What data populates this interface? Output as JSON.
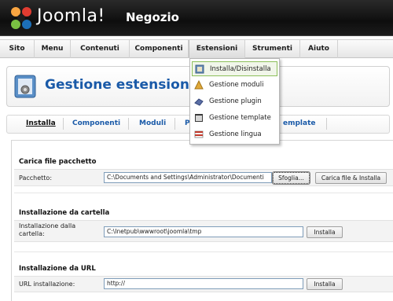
{
  "header": {
    "brand": "Joomla!",
    "site_name": "Negozio"
  },
  "menu": {
    "items": [
      "Sito",
      "Menu",
      "Contenuti",
      "Componenti",
      "Estensioni",
      "Strumenti",
      "Aiuto"
    ]
  },
  "dropdown": {
    "items": [
      {
        "label": "Installa/Disinstalla",
        "icon": "install-icon"
      },
      {
        "label": "Gestione moduli",
        "icon": "module-icon"
      },
      {
        "label": "Gestione plugin",
        "icon": "plugin-icon"
      },
      {
        "label": "Gestione template",
        "icon": "template-icon"
      },
      {
        "label": "Gestione lingua",
        "icon": "language-icon"
      }
    ]
  },
  "page": {
    "title": "Gestione estensioni"
  },
  "tabs": [
    "Installa",
    "Componenti",
    "Moduli",
    "Pl",
    "emplate"
  ],
  "upload": {
    "title": "Carica file pacchetto",
    "label": "Pacchetto:",
    "value": "C:\\Documents and Settings\\Administrator\\Documenti",
    "browse_label": "Sfoglia...",
    "submit_label": "Carica file & Installa"
  },
  "dir_install": {
    "title": "Installazione da cartella",
    "label": "Installazione dalla cartella:",
    "value": "C:\\Inetpub\\wwwroot\\joomla\\tmp",
    "button_label": "Installa"
  },
  "url_install": {
    "title": "Installazione da URL",
    "label": "URL installazione:",
    "value": "http://",
    "button_label": "Installa"
  },
  "colors": {
    "accent": "#1a5aa8",
    "header_bg": "#111111",
    "active_highlight": "#8cbf5a"
  }
}
